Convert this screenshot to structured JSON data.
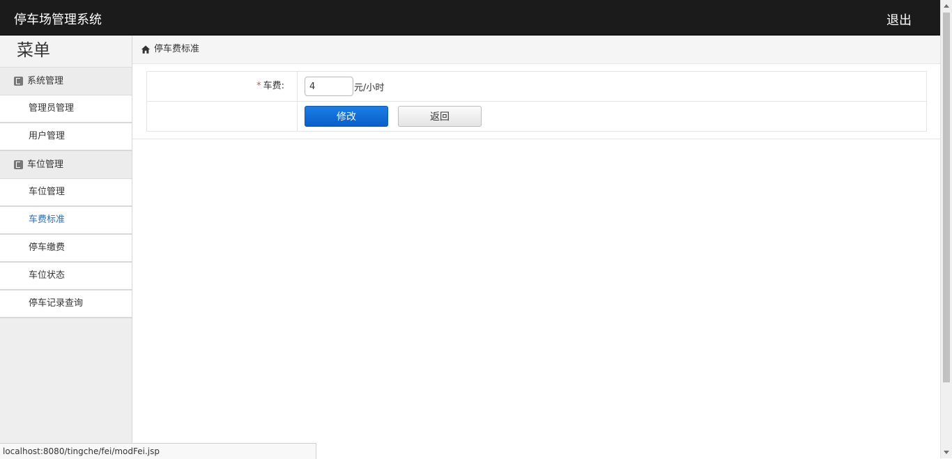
{
  "header": {
    "title": "停车场管理系统",
    "logout_label": "退出"
  },
  "sidebar": {
    "menu_title": "菜单",
    "groups": [
      {
        "label": "系统管理",
        "items": [
          "管理员管理",
          "用户管理"
        ]
      },
      {
        "label": "车位管理",
        "items": [
          "车位管理",
          "车费标准",
          "停车缴费",
          "车位状态",
          "停车记录查询"
        ]
      }
    ],
    "active_item": "车费标准"
  },
  "breadcrumb": {
    "icon": "home-icon",
    "label": "停车费标准"
  },
  "form": {
    "fee_label": "车费:",
    "fee_value": "4",
    "fee_unit": "元/小时",
    "submit_label": "修改",
    "back_label": "返回"
  },
  "status_bar": {
    "url": "localhost:8080/tingche/fei/modFei.jsp"
  },
  "colors": {
    "topbar": "#1b1b1b",
    "primary_button": "#0b5ec9",
    "active_menu": "#2a6db5",
    "required": "#d9534f"
  }
}
